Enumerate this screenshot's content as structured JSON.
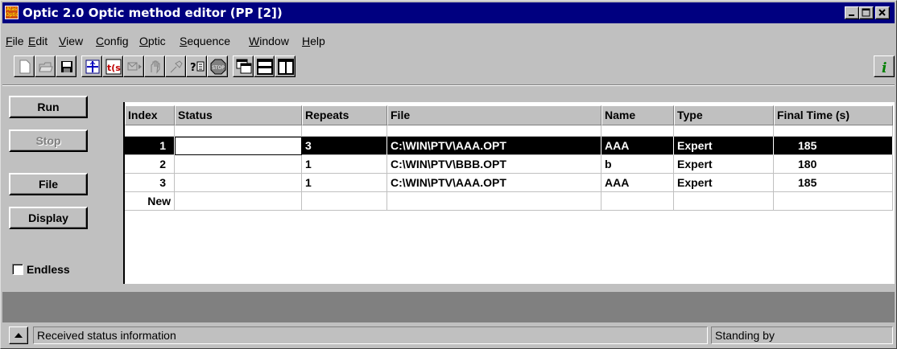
{
  "window": {
    "title": "Optic 2.0 Optic method editor (PP [2])",
    "icon_label": "Atas Optic",
    "controls": [
      "minimize-icon",
      "maximize-icon",
      "close-icon"
    ]
  },
  "menu": [
    {
      "label": "File",
      "accel": "F",
      "rest": "ile"
    },
    {
      "label": "Edit",
      "accel": "E",
      "rest": "dit"
    },
    {
      "label": "View",
      "accel": "V",
      "rest": "iew"
    },
    {
      "label": "Config",
      "accel": "C",
      "rest": "onfig"
    },
    {
      "label": "Optic",
      "accel": "O",
      "rest": "ptic"
    },
    {
      "label": "Sequence",
      "accel": "S",
      "rest": "equence"
    },
    {
      "label": "Window",
      "accel": "W",
      "rest": "indow"
    },
    {
      "label": "Help",
      "accel": "H",
      "rest": "elp"
    }
  ],
  "toolbar": {
    "buttons": [
      "new-file-icon",
      "open-folder-icon",
      "save-disk-icon",
      "crosshair-icon",
      "time-program-icon",
      "send-icon",
      "hand-icon",
      "pin-icon",
      "query-icon",
      "stop-icon",
      "cascade-windows-icon",
      "tile-horizontal-icon",
      "tile-vertical-icon",
      "info-icon"
    ],
    "time_label": "t(s)",
    "query_label": "?",
    "stop_label": "STOP",
    "info_label": "i"
  },
  "side": {
    "run": "Run",
    "stop": "Stop",
    "file": "File",
    "display": "Display",
    "endless": "Endless",
    "endless_checked": false
  },
  "table": {
    "columns": [
      "Index",
      "Status",
      "Repeats",
      "File",
      "Name",
      "Type",
      "Final Time (s)"
    ],
    "rows": [
      {
        "index": "1",
        "status": "",
        "repeats": "3",
        "file": "C:\\WIN\\PTV\\AAA.OPT",
        "name": "AAA",
        "type": "Expert",
        "final_time": "185",
        "selected": true
      },
      {
        "index": "2",
        "status": "",
        "repeats": "1",
        "file": "C:\\WIN\\PTV\\BBB.OPT",
        "name": "b",
        "type": "Expert",
        "final_time": "180",
        "selected": false
      },
      {
        "index": "3",
        "status": "",
        "repeats": "1",
        "file": "C:\\WIN\\PTV\\AAA.OPT",
        "name": "AAA",
        "type": "Expert",
        "final_time": "185",
        "selected": false
      }
    ],
    "new_row_label": "New"
  },
  "status": {
    "message": "Received status information",
    "state": "Standing by"
  },
  "colors": {
    "titlebar": "#000080",
    "face": "#c0c0c0",
    "selection": "#000000"
  }
}
